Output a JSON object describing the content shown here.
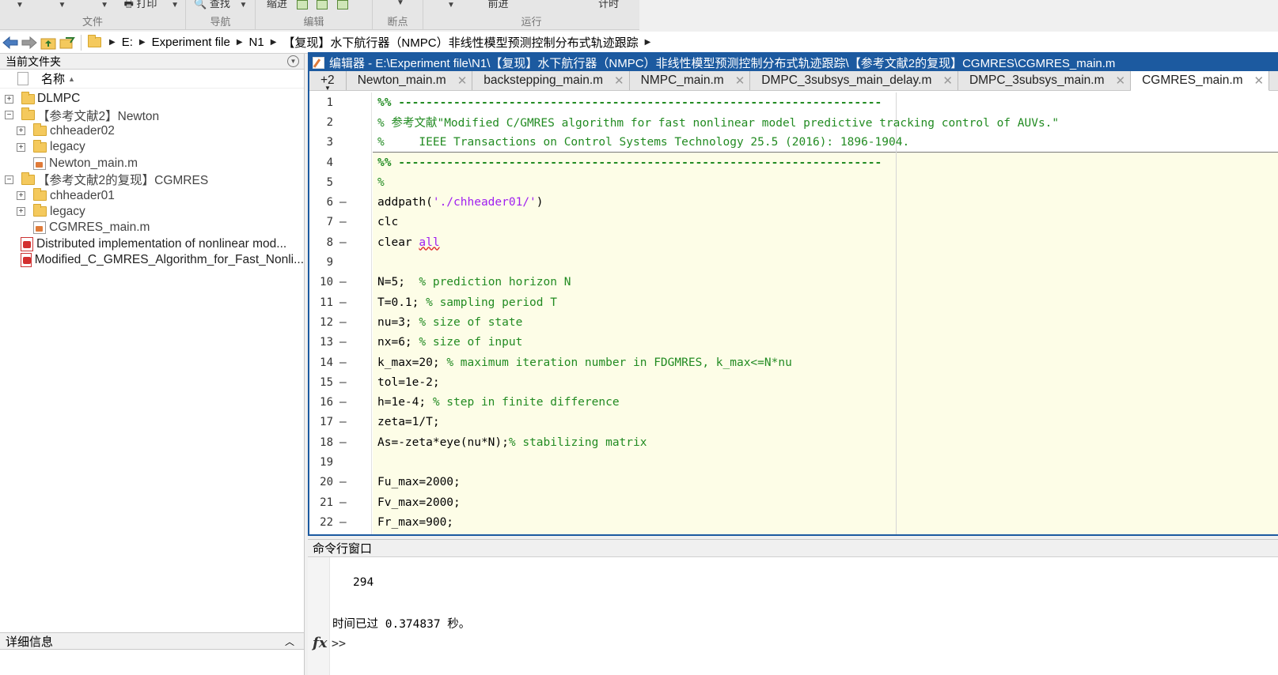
{
  "ribbon": {
    "sections": [
      {
        "label": "文件",
        "top": ""
      },
      {
        "label": "导航",
        "top": "打印"
      },
      {
        "label": "编辑",
        "top": "查找"
      },
      {
        "label": "断点",
        "top": "缩进"
      },
      {
        "label": "运行",
        "top": "前进"
      }
    ],
    "timer_label": "计时"
  },
  "address_bar": {
    "segments": [
      "E:",
      "Experiment file",
      "N1",
      "【复现】水下航行器（NMPC）非线性模型预测控制分布式轨迹跟踪"
    ]
  },
  "file_browser": {
    "title": "当前文件夹",
    "column_name": "名称",
    "items": [
      {
        "name": "DLMPC",
        "type": "folder",
        "toggle": "+"
      },
      {
        "name": "【参考文献2】Newton",
        "type": "folder",
        "toggle": "−"
      },
      {
        "name": "chheader02",
        "type": "folder",
        "toggle": "+"
      },
      {
        "name": "legacy",
        "type": "folder",
        "toggle": "+"
      },
      {
        "name": "Newton_main.m",
        "type": "m-file",
        "toggle": ""
      },
      {
        "name": "【参考文献2的复现】CGMRES",
        "type": "folder",
        "toggle": "−"
      },
      {
        "name": "chheader01",
        "type": "folder",
        "toggle": "+"
      },
      {
        "name": "legacy",
        "type": "folder",
        "toggle": "+"
      },
      {
        "name": "CGMRES_main.m",
        "type": "m-file",
        "toggle": ""
      },
      {
        "name": "Distributed implementation of nonlinear mod...",
        "type": "pdf",
        "toggle": ""
      },
      {
        "name": "Modified_C_GMRES_Algorithm_for_Fast_Nonli...",
        "type": "pdf",
        "toggle": ""
      }
    ],
    "details_label": "详细信息"
  },
  "editor": {
    "title": "编辑器 - E:\\Experiment file\\N1\\【复现】水下航行器（NMPC）非线性模型预测控制分布式轨迹跟踪\\【参考文献2的复现】CGMRES\\CGMRES_main.m",
    "tabs_more": "+2",
    "tabs": [
      {
        "label": "Newton_main.m",
        "active": false
      },
      {
        "label": "backstepping_main.m",
        "active": false
      },
      {
        "label": "NMPC_main.m",
        "active": false
      },
      {
        "label": "DMPC_3subsys_main_delay.m",
        "active": false
      },
      {
        "label": "DMPC_3subsys_main.m",
        "active": false
      },
      {
        "label": "CGMRES_main.m",
        "active": true
      }
    ],
    "lines": [
      {
        "n": "1",
        "dash": false
      },
      {
        "n": "2",
        "dash": false
      },
      {
        "n": "3",
        "dash": false
      },
      {
        "n": "4",
        "dash": false
      },
      {
        "n": "5",
        "dash": false
      },
      {
        "n": "6",
        "dash": true
      },
      {
        "n": "7",
        "dash": true
      },
      {
        "n": "8",
        "dash": true
      },
      {
        "n": "9",
        "dash": false
      },
      {
        "n": "10",
        "dash": true
      },
      {
        "n": "11",
        "dash": true
      },
      {
        "n": "12",
        "dash": true
      },
      {
        "n": "13",
        "dash": true
      },
      {
        "n": "14",
        "dash": true
      },
      {
        "n": "15",
        "dash": true
      },
      {
        "n": "16",
        "dash": true
      },
      {
        "n": "17",
        "dash": true
      },
      {
        "n": "18",
        "dash": true
      },
      {
        "n": "19",
        "dash": false
      },
      {
        "n": "20",
        "dash": true
      },
      {
        "n": "21",
        "dash": true
      },
      {
        "n": "22",
        "dash": true
      }
    ],
    "code": {
      "l1": "%% ----------------------------------------------------------------------",
      "l2": "% 参考文献\"Modified C/GMRES algorithm for fast nonlinear model predictive tracking control of AUVs.\"",
      "l3": "%     IEEE Transactions on Control Systems Technology 25.5 (2016): 1896-1904.",
      "l4": "%% ----------------------------------------------------------------------",
      "l5": "%",
      "l6a": "addpath(",
      "l6b": "'./chheader01/'",
      "l6c": ")",
      "l7": "clc",
      "l8a": "clear ",
      "l8b": "all",
      "l10a": "N=5;  ",
      "l10b": "% prediction horizon N",
      "l11a": "T=0.1; ",
      "l11b": "% sampling period T",
      "l12a": "nu=3; ",
      "l12b": "% size of state",
      "l13a": "nx=6; ",
      "l13b": "% size of input",
      "l14a": "k_max=20; ",
      "l14b": "% maximum iteration number in FDGMRES, k_max<=N*nu",
      "l15": "tol=1e-2;",
      "l16a": "h=1e-4; ",
      "l16b": "% step in finite difference",
      "l17": "zeta=1/T;",
      "l18a": "As=-zeta*eye(nu*N);",
      "l18b": "% stabilizing matrix",
      "l20": "Fu_max=2000;",
      "l21": "Fv_max=2000;",
      "l22": "Fr_max=900;"
    }
  },
  "command_window": {
    "title": "命令行窗口",
    "output_value": "294",
    "elapsed_text": "时间已过 0.374837 秒。",
    "fx": "fx",
    "prompt": ">>"
  }
}
